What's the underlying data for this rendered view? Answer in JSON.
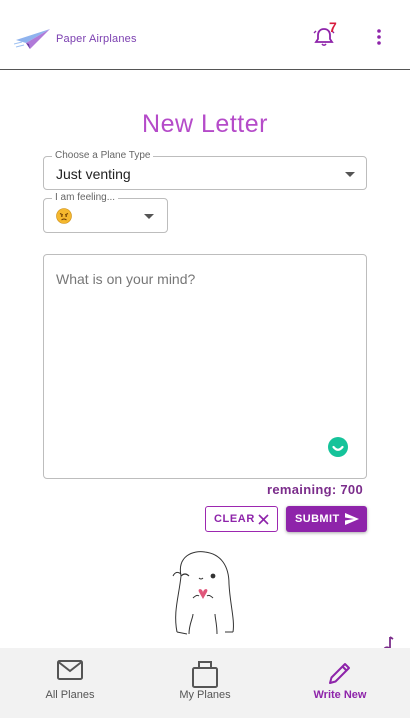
{
  "header": {
    "app_name": "Paper Airplanes",
    "notification_count": "7",
    "icons": {
      "logo": "paper-plane-logo",
      "notifications": "bell-icon",
      "menu": "more-vert-icon"
    }
  },
  "page": {
    "title": "New Letter"
  },
  "form": {
    "plane_type_label": "Choose a Plane Type",
    "plane_type_value": "Just venting",
    "feeling_label": "I am feeling...",
    "feeling_value_icon": "angry-face-emoji",
    "message_placeholder": "What is on your mind?",
    "remaining_label": "remaining: 700",
    "clear_label": "CLEAR",
    "submit_label": "SUBMIT"
  },
  "bottom_nav": {
    "items": [
      {
        "label": "All Planes",
        "icon": "mail-icon",
        "active": false
      },
      {
        "label": "My Planes",
        "icon": "inbox-stack-icon",
        "active": false
      },
      {
        "label": "Write New",
        "icon": "pencil-icon",
        "active": true
      }
    ]
  },
  "colors": {
    "accent": "#8e24aa",
    "title": "#b54bc9",
    "notification": "#d81b3c",
    "grammar_badge": "#15c39a"
  }
}
